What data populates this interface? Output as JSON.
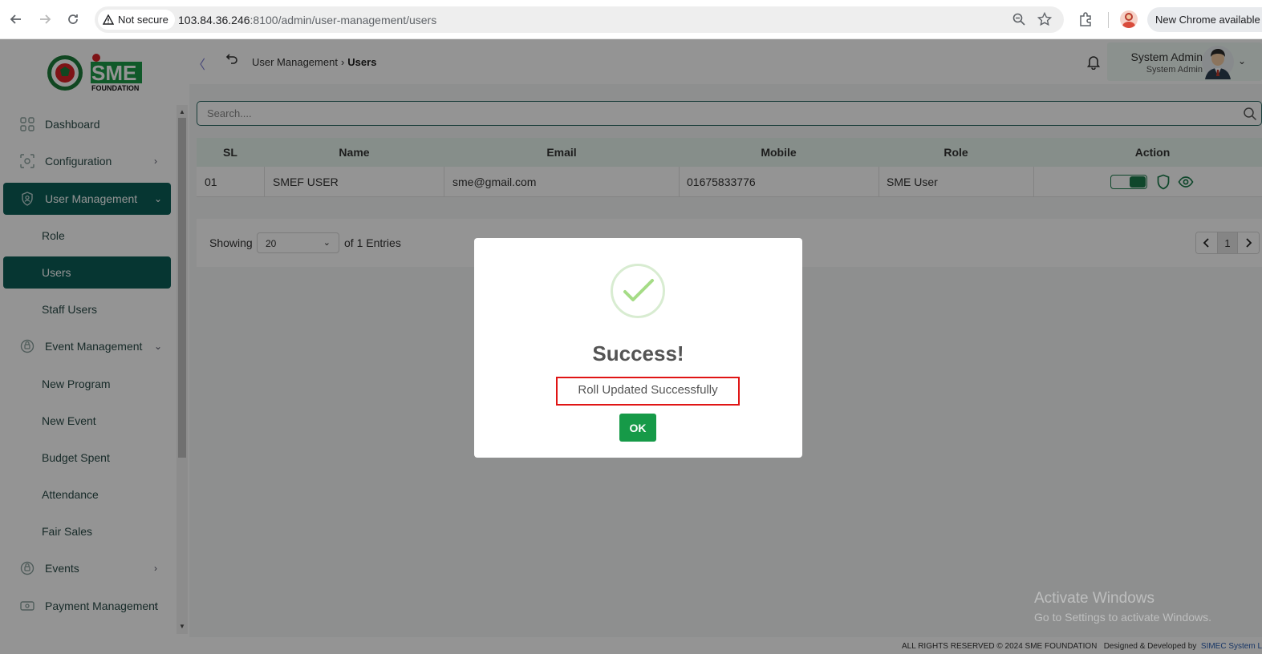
{
  "browser": {
    "security_label": "Not secure",
    "url_host": "103.84.36.246",
    "url_rest": ":8100/admin/user-management/users",
    "update_label": "New Chrome available"
  },
  "brand": {
    "logo_text": "SME",
    "logo_subtext": "FOUNDATION"
  },
  "sidebar": {
    "items": [
      {
        "label": "Dashboard",
        "icon": "grid-icon"
      },
      {
        "label": "Configuration",
        "icon": "config-icon",
        "caret": "›"
      },
      {
        "label": "User Management",
        "icon": "shield-user-icon",
        "caret": "⌄",
        "active": true
      },
      {
        "label": "Role"
      },
      {
        "label": "Users",
        "active": true
      },
      {
        "label": "Staff Users"
      },
      {
        "label": "Event Management",
        "icon": "event-icon",
        "caret": "⌄"
      },
      {
        "label": "New Program"
      },
      {
        "label": "New Event"
      },
      {
        "label": "Budget Spent"
      },
      {
        "label": "Attendance"
      },
      {
        "label": "Fair Sales"
      },
      {
        "label": "Events",
        "icon": "events-icon",
        "caret": "›"
      },
      {
        "label": "Payment Management",
        "icon": "payment-icon",
        "caret": "›"
      }
    ]
  },
  "header": {
    "breadcrumb_parent": "User Management",
    "breadcrumb_sep": "›",
    "breadcrumb_current": "Users",
    "user_name": "System Admin",
    "user_role": "System Admin"
  },
  "search": {
    "placeholder": "Search...."
  },
  "table": {
    "columns": [
      "SL",
      "Name",
      "Email",
      "Mobile",
      "Role",
      "Action"
    ],
    "rows": [
      {
        "sl": "01",
        "name": "SMEF USER",
        "email": "sme@gmail.com",
        "mobile": "01675833776",
        "role": "SME User",
        "active": true
      }
    ]
  },
  "pagination": {
    "showing_label": "Showing",
    "per_page": "20",
    "entries_label": "of 1 Entries",
    "current_page": "1"
  },
  "footer": {
    "copyright": "ALL RIGHTS RESERVED © 2024 SME FOUNDATION",
    "designed_by": "Designed & Developed by",
    "developer": "SIMEC System Lt"
  },
  "modal": {
    "title": "Success!",
    "message": "Roll Updated Successfully",
    "ok_label": "OK"
  },
  "watermark": {
    "line1": "Activate Windows",
    "line2": "Go to Settings to activate Windows."
  },
  "colors": {
    "primary": "#0b5d57",
    "success_button": "#169a48",
    "highlight_border": "#e01515",
    "table_header": "#e7f5ee"
  }
}
